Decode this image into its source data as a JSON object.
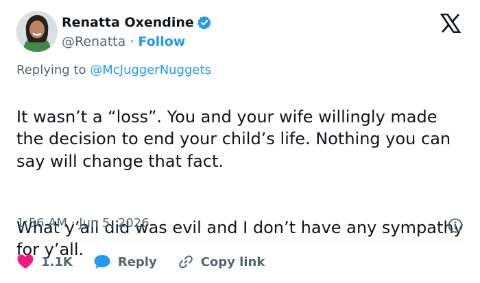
{
  "author": {
    "name": "Renatta Oxendine",
    "handle": "@Renatta",
    "separator": "·",
    "follow_label": "Follow"
  },
  "reply_context": {
    "prefix": "Replying to",
    "mention": "@McJuggerNuggets"
  },
  "tweet": {
    "paragraph1": "It wasn’t a “loss”. You and your wife willingly made the decision to end your child’s life. Nothing you can say will change that fact.",
    "paragraph2": "What y’all did was evil and I don’t have any sympathy for y’all."
  },
  "meta": {
    "timestamp": "1:56 AM · Jun 5, 2026"
  },
  "actions": {
    "likes_count": "1.1K",
    "reply_label": "Reply",
    "copy_link_label": "Copy link"
  },
  "colors": {
    "accent": "#1d9bf0",
    "like": "#f91880",
    "text": "#0f1419",
    "muted": "#536471"
  },
  "icons": {
    "verified": "verified-badge-icon",
    "logo": "x-logo-icon",
    "info": "info-icon",
    "like": "heart-icon",
    "reply": "speech-bubble-icon",
    "copy": "link-icon"
  }
}
